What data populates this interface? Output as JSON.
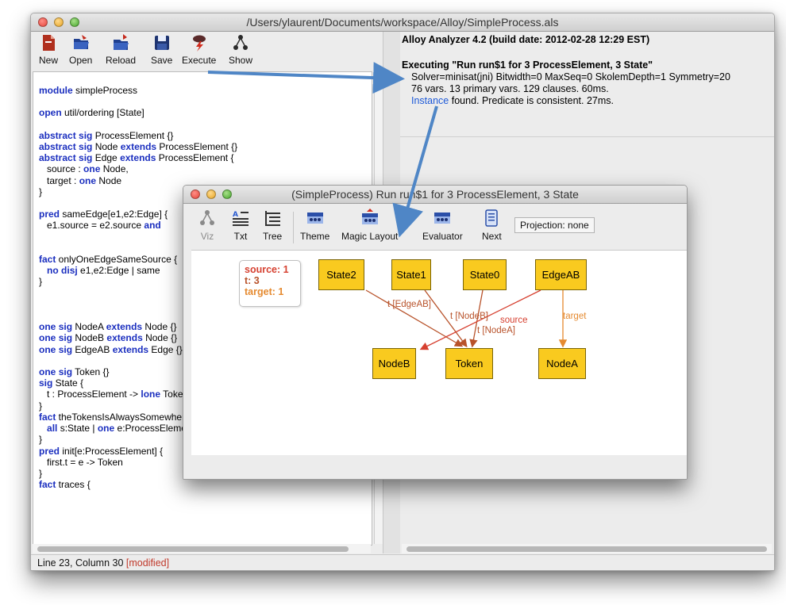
{
  "main_window": {
    "title": "/Users/ylaurent/Documents/workspace/Alloy/SimpleProcess.als",
    "toolbar": [
      {
        "label": "New",
        "icon": "new-file-icon"
      },
      {
        "label": "Open",
        "icon": "open-folder-icon"
      },
      {
        "label": "Reload",
        "icon": "reload-icon"
      },
      {
        "label": "Save",
        "icon": "save-disk-icon"
      },
      {
        "label": "Execute",
        "icon": "execute-lightning-icon"
      },
      {
        "label": "Show",
        "icon": "show-tree-icon"
      }
    ],
    "status": {
      "position": "Line 23, Column 30",
      "modified": "[modified]"
    }
  },
  "code_lines": [
    "module simpleProcess",
    "",
    "open util/ordering [State]",
    "",
    "abstract sig ProcessElement {}",
    "abstract sig Node extends ProcessElement {}",
    "abstract sig Edge extends ProcessElement {",
    "   source : one Node,",
    "   target : one Node",
    "}",
    "",
    "pred sameEdge[e1,e2:Edge] {",
    "   e1.source = e2.source and",
    "",
    "",
    "fact onlyOneEdgeSameSource {",
    "   no disj e1,e2:Edge | same",
    "}",
    "",
    "",
    "",
    "one sig NodeA extends Node {}",
    "one sig NodeB extends Node {}",
    "one sig EdgeAB extends Edge {}",
    "",
    "one sig Token {}",
    "sig State {",
    "   t : ProcessElement -> lone Token",
    "}",
    "fact theTokensIsAlwaysSomewhere {",
    "   all s:State | one e:ProcessElement",
    "}",
    "pred init[e:ProcessElement] {",
    "   first.t = e -> Token",
    "}",
    "fact traces {"
  ],
  "log": {
    "header": "Alloy Analyzer 4.2 (build date: 2012-02-28 12:29 EST)",
    "executing": "Executing \"Run run$1 for 3 ProcessElement, 3 State\"",
    "solver": "Solver=minisat(jni) Bitwidth=0 MaxSeq=0 SkolemDepth=1 Symmetry=20",
    "stats": "76 vars. 13 primary vars. 129 clauses. 60ms.",
    "instance_link": "Instance",
    "instance_rest": " found. Predicate is consistent. 27ms."
  },
  "viz_window": {
    "title": "(SimpleProcess) Run run$1 for 3 ProcessElement, 3 State",
    "toolbar": [
      {
        "label": "Viz",
        "icon": "viz-graph-icon",
        "enabled": false
      },
      {
        "label": "Txt",
        "icon": "text-icon",
        "enabled": true
      },
      {
        "label": "Tree",
        "icon": "tree-icon",
        "enabled": true
      },
      {
        "label": "Theme",
        "icon": "theme-icon",
        "enabled": true
      },
      {
        "label": "Magic Layout",
        "icon": "magic-layout-icon",
        "enabled": true
      },
      {
        "label": "Evaluator",
        "icon": "evaluator-icon",
        "enabled": true
      },
      {
        "label": "Next",
        "icon": "next-icon",
        "enabled": true
      }
    ],
    "projection": "Projection: none",
    "legend": [
      "source: 1",
      "t: 3",
      "target: 1"
    ],
    "nodes": [
      "State2",
      "State1",
      "State0",
      "EdgeAB",
      "NodeB",
      "Token",
      "NodeA"
    ],
    "edge_labels": [
      "t [EdgeAB]",
      "t [NodeB]",
      "source",
      "t [NodeA]",
      "target"
    ],
    "colors": {
      "node_fill": "#f9ca1f",
      "source_edge": "#d64030",
      "t_edge": "#b8522a",
      "target_edge": "#e58a30"
    }
  },
  "annotation_arrow_color": "#4f86c6"
}
